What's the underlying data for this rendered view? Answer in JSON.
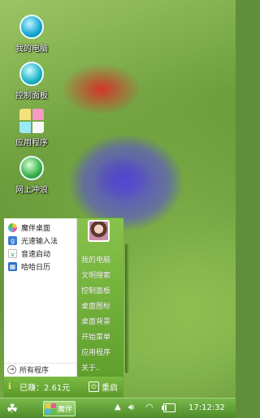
{
  "desktop": {
    "icons": [
      {
        "label": "我的电脑",
        "icon": "my-computer-icon"
      },
      {
        "label": "控制面板",
        "icon": "control-panel-icon"
      },
      {
        "label": "应用程序",
        "icon": "applications-icon"
      },
      {
        "label": "网上冲浪",
        "icon": "internet-icon"
      }
    ]
  },
  "start_menu": {
    "left_items": [
      {
        "label": "魔伴桌面",
        "icon": "mobile-desktop-icon"
      },
      {
        "label": "光速输入法",
        "icon": "input-method-icon"
      },
      {
        "label": "音速启动",
        "icon": "quick-launch-icon"
      },
      {
        "label": "哈哈日历",
        "icon": "calendar-icon"
      }
    ],
    "all_programs": "所有程序",
    "right_items": [
      "我的电脑",
      "文明搜索",
      "控制面板",
      "桌面图标",
      "桌面背景",
      "开始菜单",
      "应用程序",
      "关于.."
    ],
    "footer": {
      "earned": "已赚：2.61元",
      "restart": "重启"
    }
  },
  "taskbar": {
    "task_label": "魔伴",
    "clock": "17:12:32",
    "battery_level_percent": 20
  },
  "colors": {
    "accent_green": "#6aa13a"
  }
}
